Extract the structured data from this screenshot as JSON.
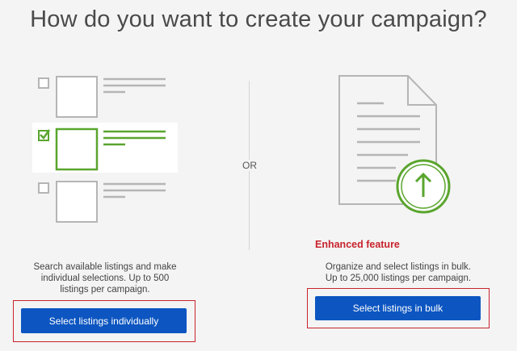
{
  "page": {
    "title": "How do you want to create your campaign?"
  },
  "divider": {
    "label": "OR"
  },
  "individual": {
    "description_lines": [
      "Search available listings and make",
      "individual selections. Up to 500",
      "listings per campaign."
    ],
    "button_label": "Select listings individually"
  },
  "bulk": {
    "badge": "Enhanced feature",
    "description_lines": [
      "Organize and select listings in bulk.",
      "Up to 25,000 listings per campaign."
    ],
    "button_label": "Select listings in bulk"
  },
  "colors": {
    "accent_green": "#5aa52e",
    "button_blue": "#0d56c1",
    "highlight_red": "#c8232c",
    "illustration_gray": "#b5b5b5"
  },
  "icons": [
    "checkbox-list-illustration",
    "upload-document-illustration",
    "upload-arrow-icon"
  ]
}
